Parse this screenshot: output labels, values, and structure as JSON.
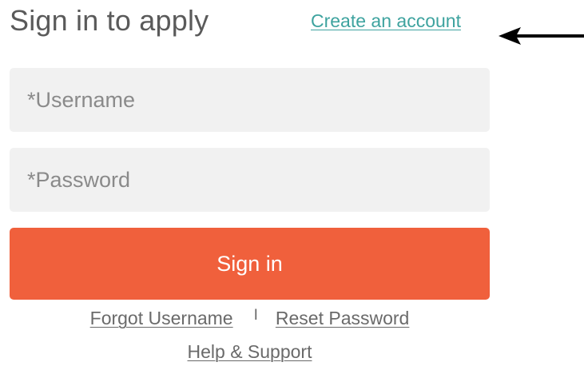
{
  "header": {
    "title": "Sign in to apply",
    "create_account_link": "Create an account"
  },
  "form": {
    "username_placeholder": "*Username",
    "password_placeholder": "*Password",
    "signin_label": "Sign in"
  },
  "footer_links": {
    "forgot_username": "Forgot Username",
    "separator": "I",
    "reset_password": "Reset Password",
    "help_support": "Help & Support"
  },
  "annotation": {
    "arrow_icon": "left-arrow-icon"
  },
  "colors": {
    "title_text": "#5a5a5a",
    "link_accent": "#3ea39f",
    "input_background": "#f1f1f1",
    "button_background": "#f0603c",
    "button_text": "#ffffff",
    "footer_link": "#6a6a6a",
    "arrow": "#000000"
  }
}
